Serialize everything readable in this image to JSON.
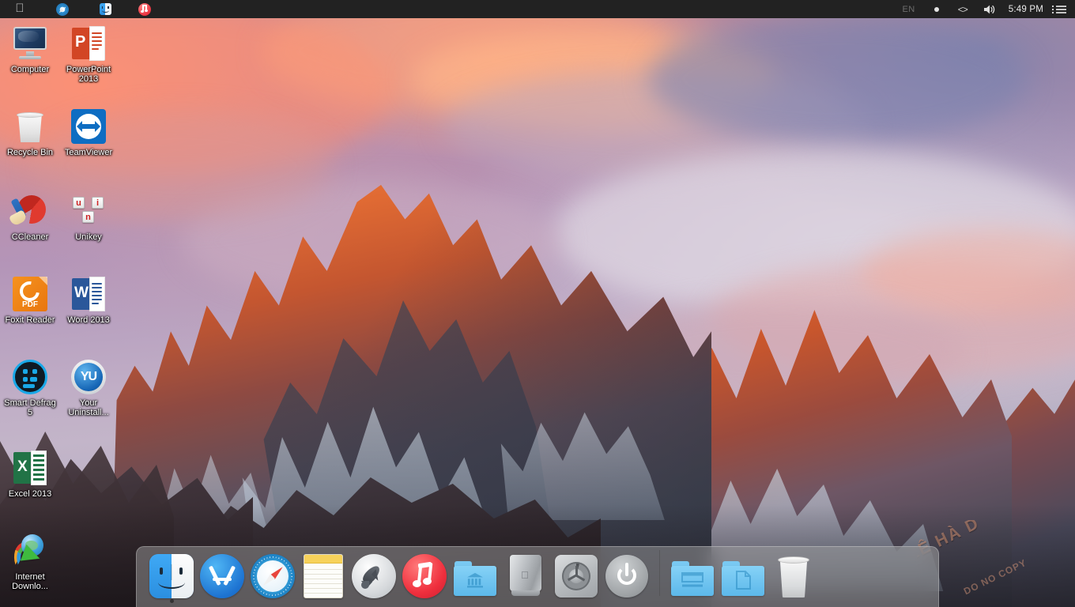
{
  "menubar": {
    "apple_icon": "apple-logo-icon",
    "left_icons": [
      {
        "name": "apple-menu-icon",
        "glyph": "apple"
      },
      {
        "name": "safari-menubar-icon",
        "glyph": "safari"
      },
      {
        "name": "finder-menubar-icon",
        "glyph": "finder"
      },
      {
        "name": "itunes-menubar-icon",
        "glyph": "itunes"
      }
    ],
    "tray": {
      "input_source": "EN",
      "status_dot": "status-dot-icon",
      "code_icon": "<>",
      "volume_icon": "volume-icon",
      "clock": "5:49 PM",
      "notification_center_icon": "notification-center-icon"
    },
    "background_color": "#222222"
  },
  "desktop": {
    "icons": [
      {
        "label": "Computer",
        "art": "imac-icon",
        "col": 0,
        "row": 0
      },
      {
        "label": "PowerPoint 2013",
        "art": "powerpoint-icon",
        "col": 1,
        "row": 0
      },
      {
        "label": "Recycle Bin",
        "art": "recycle-bin-icon",
        "col": 0,
        "row": 1
      },
      {
        "label": "TeamViewer",
        "art": "teamviewer-icon",
        "col": 1,
        "row": 1
      },
      {
        "label": "CCleaner",
        "art": "ccleaner-icon",
        "col": 0,
        "row": 2
      },
      {
        "label": "Unikey",
        "art": "unikey-icon",
        "col": 1,
        "row": 2
      },
      {
        "label": "Foxit Reader",
        "art": "foxit-reader-icon",
        "col": 0,
        "row": 3
      },
      {
        "label": "Word 2013",
        "art": "word-icon",
        "col": 1,
        "row": 3
      },
      {
        "label": "Smart Defrag 5",
        "art": "smart-defrag-icon",
        "col": 0,
        "row": 4
      },
      {
        "label": "Your Uninstall...",
        "art": "your-uninstaller-icon",
        "col": 1,
        "row": 4
      },
      {
        "label": "Excel 2013",
        "art": "excel-icon",
        "col": 0,
        "row": 5
      },
      {
        "label": "Internet Downlo...",
        "art": "internet-download-manager-icon",
        "col": 0,
        "row": 6
      }
    ]
  },
  "dock": {
    "items": [
      {
        "label": "Finder",
        "art": "finder-icon",
        "running": true
      },
      {
        "label": "App Store",
        "art": "app-store-icon",
        "running": false
      },
      {
        "label": "Safari",
        "art": "safari-icon",
        "running": false
      },
      {
        "label": "Notes",
        "art": "notes-icon",
        "running": false
      },
      {
        "label": "Launchpad",
        "art": "launchpad-icon",
        "running": false
      },
      {
        "label": "iTunes",
        "art": "itunes-icon",
        "running": false
      },
      {
        "label": "Applications",
        "art": "applications-folder-icon",
        "running": false
      },
      {
        "label": "Mac Pro",
        "art": "mac-pro-icon",
        "running": false
      },
      {
        "label": "System Preferences",
        "art": "system-preferences-icon",
        "running": false
      },
      {
        "label": "Shut Down",
        "art": "power-icon",
        "running": false
      }
    ],
    "items_right": [
      {
        "label": "Downloads",
        "art": "downloads-folder-icon"
      },
      {
        "label": "Documents",
        "art": "documents-folder-icon"
      },
      {
        "label": "Trash",
        "art": "trash-icon"
      }
    ],
    "separator": true,
    "background_color": "rgba(168,168,168,0.46)"
  },
  "wallpaper": {
    "name": "macos-sierra-mountain",
    "sky_colors": [
      "#cf8a93",
      "#b495b8",
      "#c3b5c9",
      "#63748f"
    ],
    "mountain_colors": [
      "#f07b3c",
      "#c45630",
      "#474a58",
      "#231c20"
    ]
  },
  "watermark": {
    "line1": "LÊ HÀ D",
    "line2": "DO NO COPY"
  }
}
